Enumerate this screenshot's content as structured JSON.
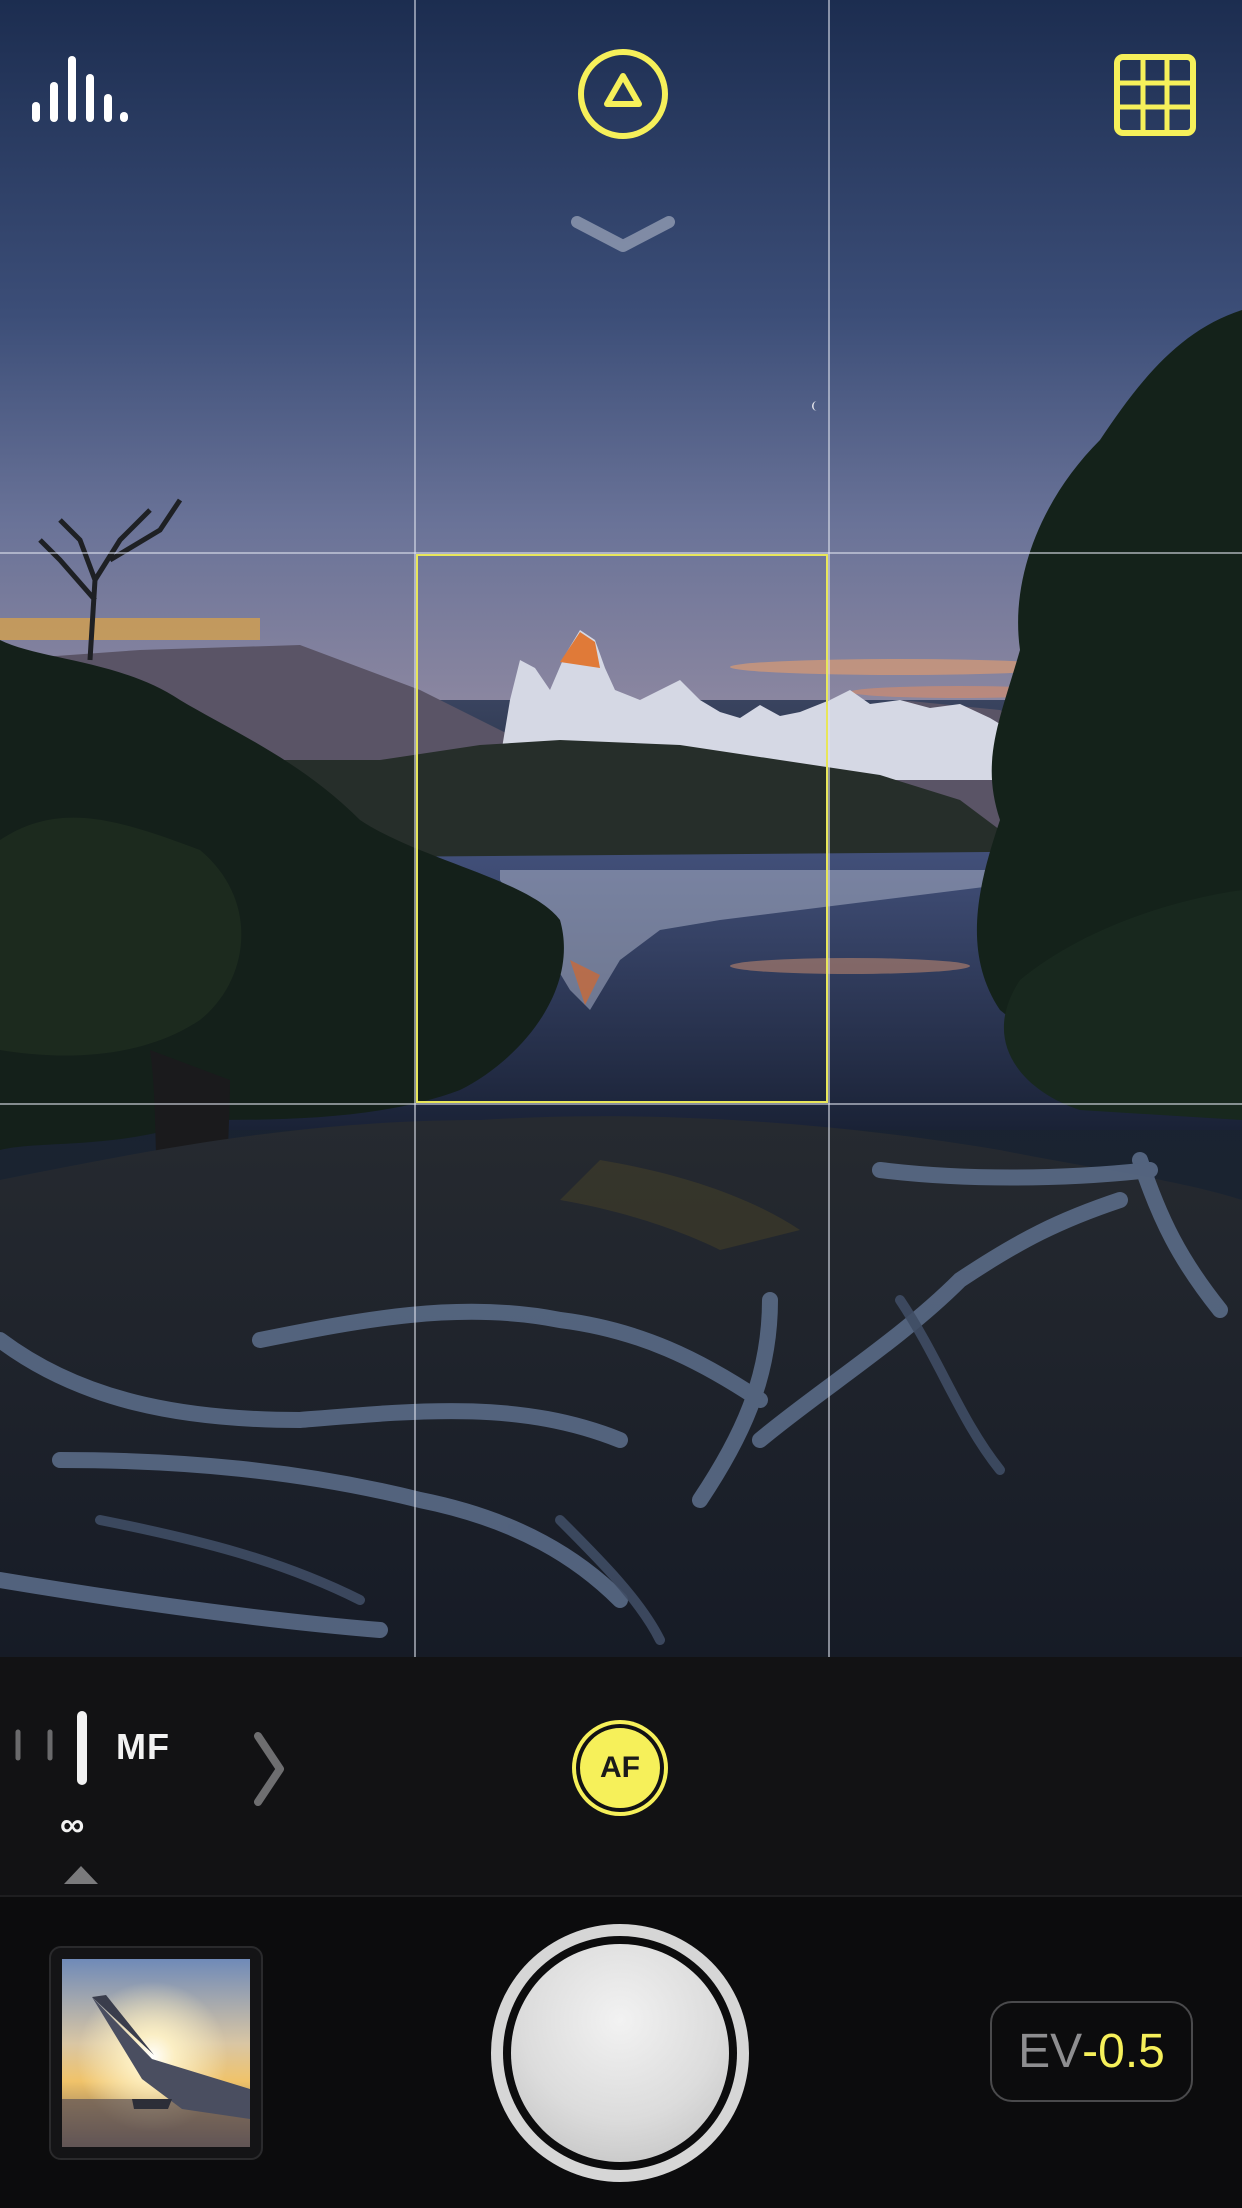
{
  "app": {
    "accent_color": "#f6f05a"
  },
  "top_bar": {
    "histogram_icon": "histogram-icon",
    "mode_icon": "triangle-mode-icon",
    "grid_icon": "grid-icon",
    "expand_icon": "chevron-down-icon"
  },
  "focus": {
    "mode_label": "MF",
    "distance_label": "∞",
    "af_label": "AF"
  },
  "exposure": {
    "ev_label": "EV",
    "ev_value": "-0.5"
  }
}
